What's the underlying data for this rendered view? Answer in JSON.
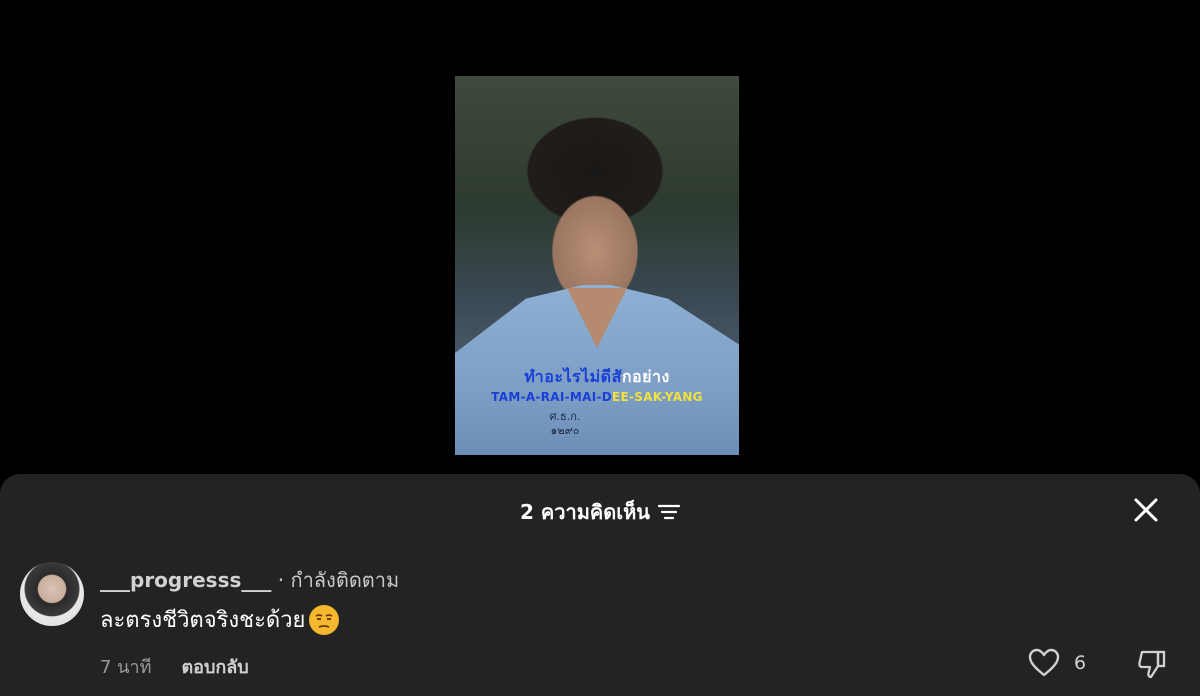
{
  "video": {
    "subtitle_thai_highlight": "ทำอะไรไม่ดีส",
    "subtitle_thai_rest": "ักอย่าง",
    "subtitle_en_highlight": "TAM-A-RAI-MAI-D",
    "subtitle_en_rest": "EE-SAK-YANG",
    "badge_line1": "ศ.ธ.ก.",
    "badge_line2": "๑๒๙๐"
  },
  "sheet": {
    "title": "2 ความคิดเห็น"
  },
  "comment": {
    "username": "___progresss___",
    "status": "· กำลังติดตาม",
    "text": "ละตรงชีวิตจริงชะด้วย",
    "time": "7 นาที",
    "reply_label": "ตอบกลับ",
    "like_count": "6"
  },
  "icons": {
    "filter": "filter-icon",
    "close": "close-icon",
    "heart": "heart-icon",
    "dislike": "thumbs-down-icon",
    "emoji": "unamused-face-emoji"
  }
}
